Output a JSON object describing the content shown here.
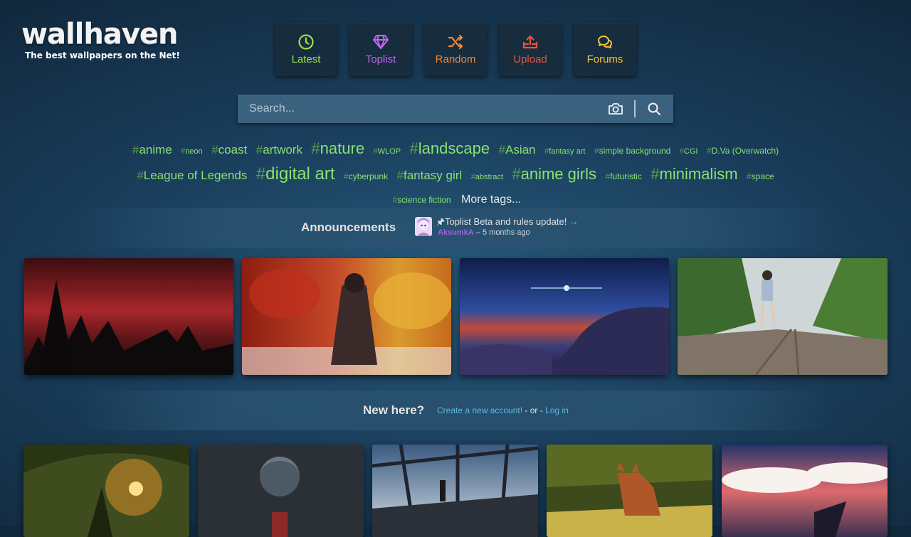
{
  "logo": {
    "text": "wallhaven",
    "tagline": "The best wallpapers on the Net!"
  },
  "nav": [
    {
      "label": "Latest",
      "icon": "clock-icon",
      "color": "#9be14e"
    },
    {
      "label": "Toplist",
      "icon": "diamond-icon",
      "color": "#c266f0"
    },
    {
      "label": "Random",
      "icon": "shuffle-icon",
      "color": "#f08a3a"
    },
    {
      "label": "Upload",
      "icon": "upload-icon",
      "color": "#e8553f"
    },
    {
      "label": "Forums",
      "icon": "chat-icon",
      "color": "#f2c23e"
    }
  ],
  "search": {
    "placeholder": "Search...",
    "camera_icon": "camera-icon",
    "search_icon": "magnifier-icon"
  },
  "tags": [
    "anime",
    "neon",
    "coast",
    "artwork",
    "nature",
    "WLOP",
    "landscape",
    "Asian",
    "fantasy art",
    "simple background",
    "CGI",
    "D.Va (Overwatch)",
    "League of Legends",
    "digital art",
    "cyberpunk",
    "fantasy girl",
    "abstract",
    "anime girls",
    "futuristic",
    "minimalism",
    "space",
    "science fiction"
  ],
  "more_tags": "More tags...",
  "announcements": {
    "title": "Announcements",
    "headline": "Toplist Beta and rules update!",
    "author": "AksumkA",
    "time": " – 5 months ago"
  },
  "new_here": {
    "title": "New here?",
    "create": "Create a new account!",
    "or": " - or - ",
    "login": "Log in"
  },
  "colors": {
    "tag": "#88e270",
    "link": "#5fb7dc",
    "author": "#a35ee0"
  }
}
